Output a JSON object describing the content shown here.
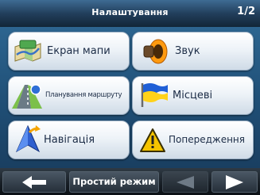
{
  "header": {
    "title": "Налаштування",
    "page": "1/2"
  },
  "tiles": [
    {
      "label": "Екран мапи",
      "icon": "map-screen-icon"
    },
    {
      "label": "Звук",
      "icon": "speaker-icon"
    },
    {
      "label": "Планування маршруту",
      "icon": "route-planning-icon"
    },
    {
      "label": "Місцеві",
      "icon": "ukraine-flag-icon"
    },
    {
      "label": "Навігація",
      "icon": "navigation-arrow-icon"
    },
    {
      "label": "Попередження",
      "icon": "warning-icon"
    }
  ],
  "footer": {
    "mode_label": "Простий режим"
  },
  "colors": {
    "accent": "#2d6590",
    "tile_text": "#1c2c46",
    "warning": "#f5c400"
  }
}
